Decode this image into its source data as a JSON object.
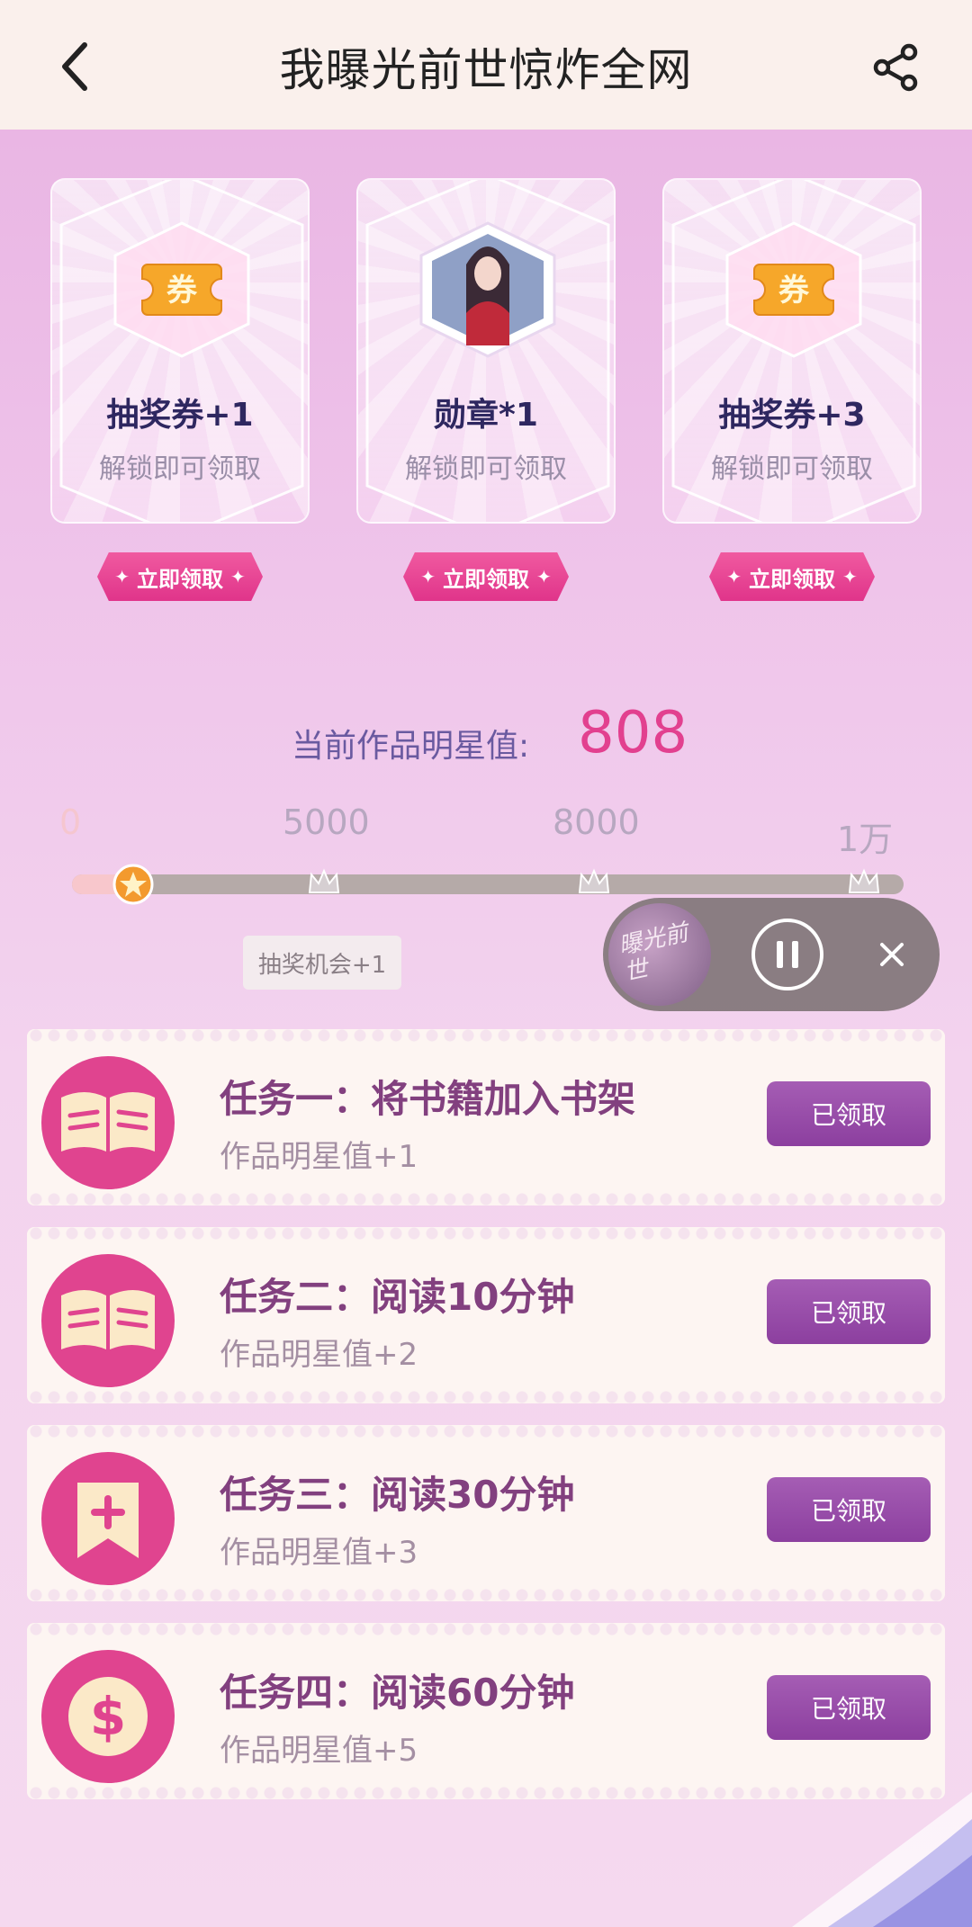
{
  "header": {
    "title": "我曝光前世惊炸全网"
  },
  "rewards": [
    {
      "title": "抽奖券+1",
      "subtitle": "解锁即可领取",
      "button": "立即领取",
      "icon": "ticket-icon",
      "icon_text": "券"
    },
    {
      "title": "勋章*1",
      "subtitle": "解锁即可领取",
      "button": "立即领取",
      "icon": "portrait-medal-icon"
    },
    {
      "title": "抽奖券+3",
      "subtitle": "解锁即可领取",
      "button": "立即领取",
      "icon": "ticket-icon",
      "icon_text": "券"
    }
  ],
  "star": {
    "label": "当前作品明星值:",
    "value": "808",
    "progress_fraction": 0.0808,
    "milestones": [
      "0",
      "5000",
      "8000",
      "1万"
    ],
    "tooltip": "抽奖机会+1"
  },
  "player": {
    "cover_text": "曝光前世"
  },
  "tasks": [
    {
      "title": "任务一：将书籍加入书架",
      "reward": "作品明星值+1",
      "button": "已领取",
      "icon": "open-book-icon"
    },
    {
      "title": "任务二：阅读10分钟",
      "reward": "作品明星值+2",
      "button": "已领取",
      "icon": "open-book-icon"
    },
    {
      "title": "任务三：阅读30分钟",
      "reward": "作品明星值+3",
      "button": "已领取",
      "icon": "bookmark-plus-icon"
    },
    {
      "title": "任务四：阅读60分钟",
      "reward": "作品明星值+5",
      "button": "已领取",
      "icon": "dollar-coin-icon"
    }
  ],
  "colors": {
    "accent_pink": "#e2408f",
    "task_button": "#8c3f9f",
    "title_dark": "#2e2760"
  }
}
